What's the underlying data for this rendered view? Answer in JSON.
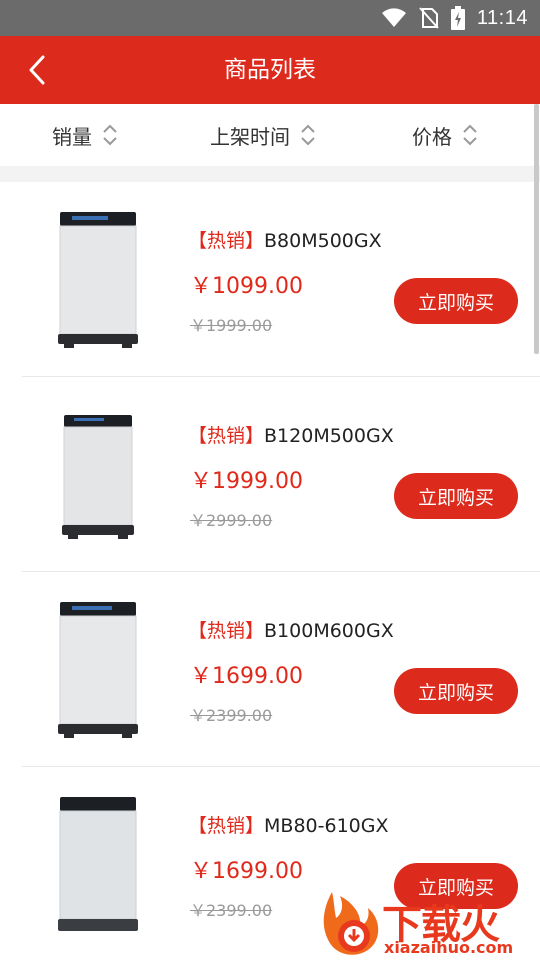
{
  "status_bar": {
    "time": "11:14"
  },
  "header": {
    "title": "商品列表"
  },
  "sort": [
    {
      "label": "销量"
    },
    {
      "label": "上架时间"
    },
    {
      "label": "价格"
    }
  ],
  "products": [
    {
      "tag": "【热销】",
      "name": "B80M500GX",
      "price": "￥1099.00",
      "old_price": "￥1999.00",
      "button": "立即购买"
    },
    {
      "tag": "【热销】",
      "name": "B120M500GX",
      "price": "￥1999.00",
      "old_price": "￥2999.00",
      "button": "立即购买"
    },
    {
      "tag": "【热销】",
      "name": "B100M600GX",
      "price": "￥1699.00",
      "old_price": "￥2399.00",
      "button": "立即购买"
    },
    {
      "tag": "【热销】",
      "name": "MB80-610GX",
      "price": "￥1699.00",
      "old_price": "￥2399.00",
      "button": "立即购买"
    }
  ],
  "watermark": {
    "title": "下载火",
    "domain": "xiazaihuo.com"
  },
  "colors": {
    "accent": "#dc2a1c",
    "status_bar": "#6b6b6b",
    "price": "#e0291b"
  }
}
